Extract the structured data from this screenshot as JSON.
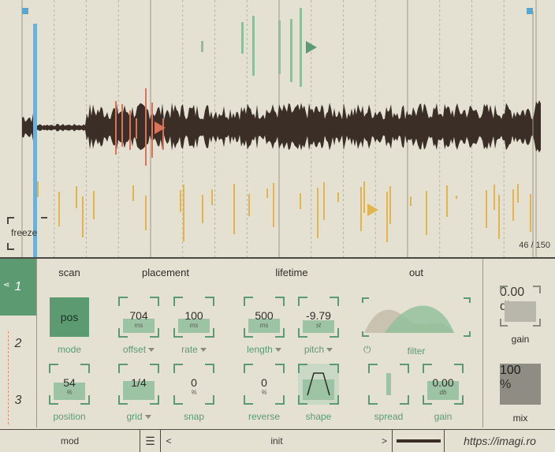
{
  "waveform": {
    "freeze_label": "freeze",
    "counter": "46 / 150"
  },
  "layers": [
    {
      "label": "1",
      "icon": "share-icon"
    },
    {
      "label": "2"
    },
    {
      "label": "3"
    }
  ],
  "sections": {
    "scan": "scan",
    "placement": "placement",
    "lifetime": "lifetime",
    "out": "out"
  },
  "scan": {
    "mode_value": "pos",
    "mode_label": "mode",
    "position_value": "54",
    "position_unit": "%",
    "position_label": "position",
    "position_level": 0.54
  },
  "placement": {
    "offset_value": "704",
    "offset_unit": "ms",
    "offset_label": "offset",
    "offset_level": 0.45,
    "rate_value": "100",
    "rate_unit": "ms",
    "rate_label": "rate",
    "rate_level": 0.45,
    "grid_value": "1/4",
    "grid_label": "grid",
    "grid_level": 0.6,
    "snap_value": "0",
    "snap_unit": "%",
    "snap_label": "snap"
  },
  "lifetime": {
    "length_value": "500",
    "length_unit": "ms",
    "length_label": "length",
    "length_level": 0.45,
    "pitch_value": "-9.79",
    "pitch_unit": "st",
    "pitch_label": "pitch",
    "pitch_level": 0.4,
    "reverse_value": "0",
    "reverse_unit": "%",
    "reverse_label": "reverse",
    "shape_label": "shape"
  },
  "out": {
    "filter_label": "filter",
    "spread_label": "spread",
    "gain_value": "0.00",
    "gain_unit": "db",
    "gain_label": "gain",
    "gain_level": 0.6
  },
  "master": {
    "gain_value": "0.00",
    "gain_unit": "db",
    "gain_label": "gain",
    "mix_value": "100",
    "mix_unit": "%",
    "mix_label": "mix"
  },
  "footer": {
    "mod_label": "mod",
    "menu_icon": "hamburger-icon",
    "prev": "<",
    "preset": "init",
    "next": ">",
    "url": "https://imagi.ro"
  },
  "colors": {
    "accent": "#5c9a72",
    "blue": "#5aa6d0",
    "red": "#d9735a",
    "yellow": "#e0b550",
    "green_grain": "#8fbf9a"
  }
}
